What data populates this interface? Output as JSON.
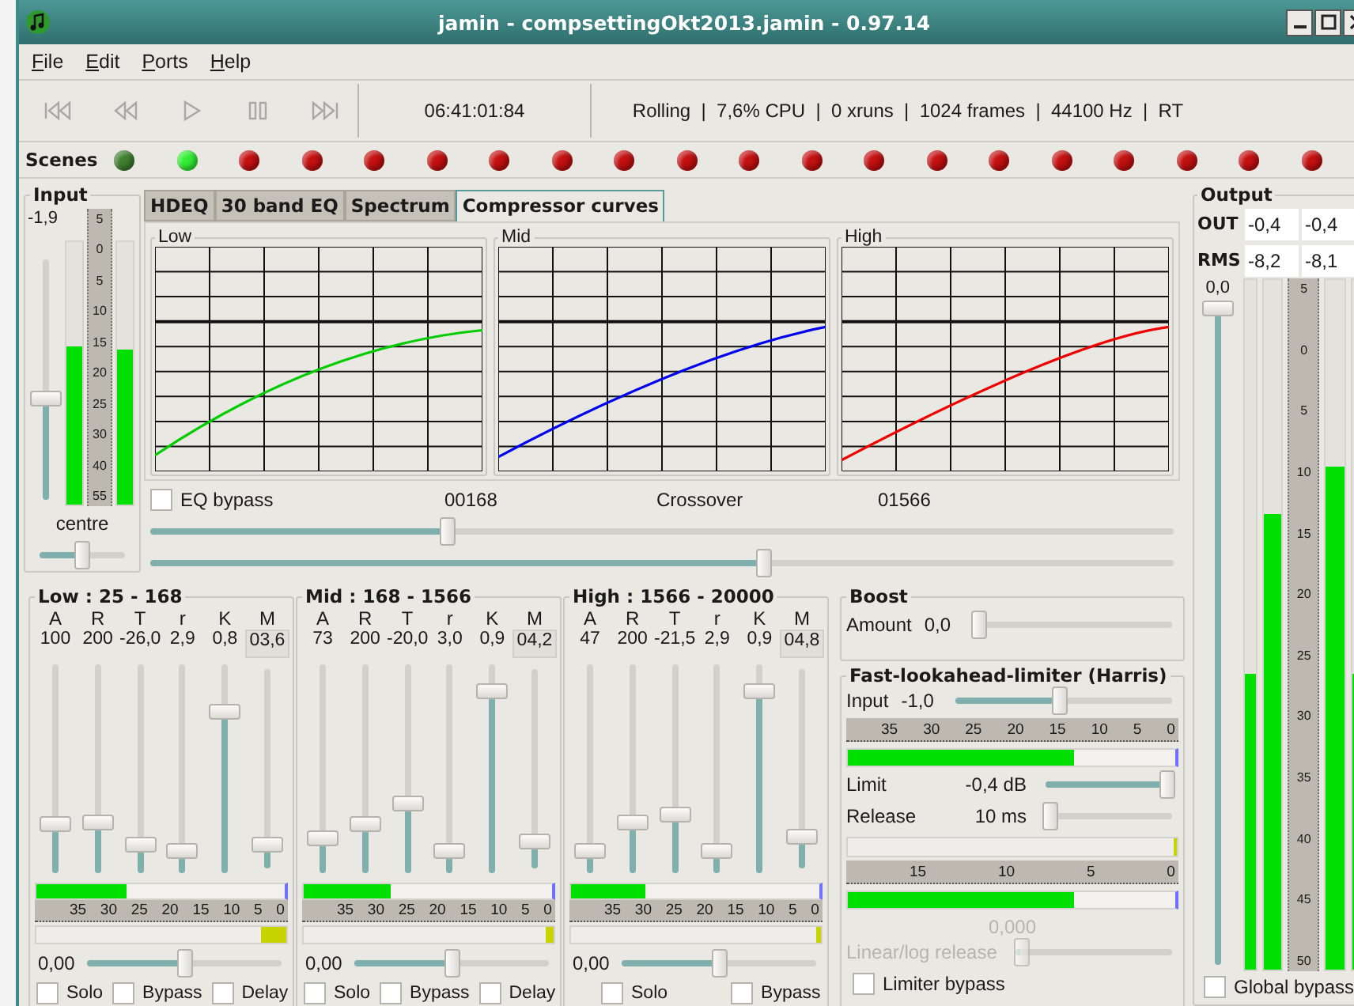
{
  "window": {
    "title": "jamin - compsettingOkt2013.jamin - 0.97.14"
  },
  "menu": [
    {
      "label": "File"
    },
    {
      "label": "Edit"
    },
    {
      "label": "Ports"
    },
    {
      "label": "Help"
    }
  ],
  "transport": {
    "buttons": [
      {
        "kind": "start"
      },
      {
        "kind": "rewind"
      },
      {
        "kind": "play"
      },
      {
        "kind": "pause"
      },
      {
        "kind": "end"
      }
    ],
    "time": "06:41:01:84",
    "status": "Rolling  |  7,6% CPU  |  0 xruns  |  1024 frames  |  44100 Hz  |  RT"
  },
  "scenes": {
    "label": "Scenes",
    "items": [
      {
        "color": "#3f7f2f"
      },
      {
        "color": "#33ee33"
      },
      {
        "color": "#c41010"
      },
      {
        "color": "#c41010"
      },
      {
        "color": "#c41010"
      },
      {
        "color": "#c41010"
      },
      {
        "color": "#c41010"
      },
      {
        "color": "#c41010"
      },
      {
        "color": "#c41010"
      },
      {
        "color": "#c41010"
      },
      {
        "color": "#c41010"
      },
      {
        "color": "#c41010"
      },
      {
        "color": "#c41010"
      },
      {
        "color": "#c41010"
      },
      {
        "color": "#c41010"
      },
      {
        "color": "#c41010"
      },
      {
        "color": "#c41010"
      },
      {
        "color": "#c41010"
      },
      {
        "color": "#c41010"
      },
      {
        "color": "#c41010"
      }
    ]
  },
  "input": {
    "title": "Input",
    "value": "-1,9",
    "fader": {
      "level": 0.42
    },
    "meters": [
      {
        "level": 0.6
      },
      {
        "level": 0.59
      }
    ],
    "scale": [
      "5",
      "0",
      "5",
      "10",
      "15",
      "20",
      "25",
      "30",
      "40",
      "55"
    ],
    "pan_label": "centre",
    "pan": {
      "level": 0.5
    }
  },
  "tabs": [
    {
      "label": "HDEQ",
      "selected": false
    },
    {
      "label": "30 band EQ",
      "selected": false
    },
    {
      "label": "Spectrum",
      "selected": false
    },
    {
      "label": "Compressor curves",
      "selected": true
    }
  ],
  "curves": [
    {
      "title": "Low",
      "color": "#00cc00"
    },
    {
      "title": "Mid",
      "color": "#0000ee"
    },
    {
      "title": "High",
      "color": "#ee0000"
    }
  ],
  "crossover": {
    "eq_bypass": {
      "label": "EQ bypass",
      "checked": false
    },
    "low_value": "00168",
    "label": "Crossover",
    "high_value": "01566",
    "sliders": [
      {
        "level": 0.29
      },
      {
        "level": 0.6
      }
    ]
  },
  "bands": [
    {
      "title": "Low : 25 - 168",
      "params": [
        {
          "label": "A",
          "value": "100",
          "kind": "fader",
          "level": 0.23
        },
        {
          "label": "R",
          "value": "200",
          "kind": "fader",
          "level": 0.24
        },
        {
          "label": "T",
          "value": "-26,0",
          "kind": "fader",
          "level": 0.13
        },
        {
          "label": "r",
          "value": "2,9",
          "kind": "fader",
          "level": 0.1
        },
        {
          "label": "K",
          "value": "0,8",
          "kind": "fader",
          "level": 0.78
        },
        {
          "label": "M",
          "value": "03,6",
          "kind": "makeup",
          "level": 0.11
        }
      ],
      "gain_meter": {
        "level": 0.36
      },
      "reduction_meter": {
        "level": 0.1
      },
      "scale": [
        "35",
        "30",
        "25",
        "20",
        "15",
        "10",
        "5",
        "0"
      ],
      "gain": {
        "value": "0,00",
        "level": 0.5
      },
      "options": [
        {
          "label": "Solo",
          "checked": false
        },
        {
          "label": "Bypass",
          "checked": false
        },
        {
          "label": "Delay",
          "checked": false
        }
      ]
    },
    {
      "title": "Mid : 168 - 1566",
      "params": [
        {
          "label": "A",
          "value": "73",
          "kind": "fader",
          "level": 0.16
        },
        {
          "label": "R",
          "value": "200",
          "kind": "fader",
          "level": 0.23
        },
        {
          "label": "T",
          "value": "-20,0",
          "kind": "fader",
          "level": 0.33
        },
        {
          "label": "r",
          "value": "3,0",
          "kind": "fader",
          "level": 0.1
        },
        {
          "label": "K",
          "value": "0,9",
          "kind": "fader",
          "level": 0.88
        },
        {
          "label": "M",
          "value": "04,2",
          "kind": "makeup",
          "level": 0.13
        }
      ],
      "gain_meter": {
        "level": 0.35
      },
      "reduction_meter": {
        "level": 0.03
      },
      "scale": [
        "35",
        "30",
        "25",
        "20",
        "15",
        "10",
        "5",
        "0"
      ],
      "gain": {
        "value": "0,00",
        "level": 0.5
      },
      "options": [
        {
          "label": "Solo",
          "checked": false
        },
        {
          "label": "Bypass",
          "checked": false
        },
        {
          "label": "Delay",
          "checked": false
        }
      ]
    },
    {
      "title": "High : 1566 - 20000",
      "params": [
        {
          "label": "A",
          "value": "47",
          "kind": "fader",
          "level": 0.1
        },
        {
          "label": "R",
          "value": "200",
          "kind": "fader",
          "level": 0.24
        },
        {
          "label": "T",
          "value": "-21,5",
          "kind": "fader",
          "level": 0.28
        },
        {
          "label": "r",
          "value": "2,9",
          "kind": "fader",
          "level": 0.1
        },
        {
          "label": "K",
          "value": "0,9",
          "kind": "fader",
          "level": 0.88
        },
        {
          "label": "M",
          "value": "04,8",
          "kind": "makeup",
          "level": 0.15
        }
      ],
      "gain_meter": {
        "level": 0.3
      },
      "reduction_meter": {
        "level": 0.02
      },
      "scale": [
        "35",
        "30",
        "25",
        "20",
        "15",
        "10",
        "5",
        "0"
      ],
      "gain": {
        "value": "0,00",
        "level": 0.5
      },
      "options": [
        {
          "label": "Solo",
          "checked": false
        },
        {
          "label": "Bypass",
          "checked": false
        }
      ]
    }
  ],
  "boost": {
    "title": "Boost",
    "label": "Amount",
    "value": "0,0",
    "level": 0
  },
  "limiter": {
    "title": "Fast-lookahead-limiter (Harris)",
    "input": {
      "label": "Input",
      "value": "-1,0",
      "level": 0.48
    },
    "input_scale": [
      "35",
      "30",
      "25",
      "20",
      "15",
      "10",
      "5",
      "0"
    ],
    "input_meter": {
      "level": 0.69
    },
    "limit": {
      "label": "Limit",
      "value": "-0,4 dB",
      "level": 0.97
    },
    "release": {
      "label": "Release",
      "value": "10 ms",
      "level": 0.02
    },
    "attenuation": {
      "level": 0.01
    },
    "attenuation_scale": [
      "15",
      "10",
      "5",
      "0"
    ],
    "output_meter": {
      "level": 0.69
    },
    "release_mode": {
      "value": "0,000",
      "label": "Linear/log release",
      "level": 0.03,
      "disabled": true
    },
    "bypass": {
      "label": "Limiter bypass",
      "checked": false
    }
  },
  "output": {
    "title": "Output",
    "rows": [
      {
        "label": "OUT",
        "values": [
          "-0,4",
          "-0,4"
        ]
      },
      {
        "label": "RMS",
        "values": [
          "-8,2",
          "-8,1"
        ]
      }
    ],
    "fader": {
      "value": "0,0",
      "level": 1
    },
    "meters": [
      {
        "kind": "rms",
        "level": 0.43
      },
      {
        "kind": "peak",
        "level": 0.66
      },
      {
        "kind": "peak",
        "level": 0.73
      },
      {
        "kind": "rms",
        "level": 0.43
      }
    ],
    "scale": [
      "5",
      "0",
      "5",
      "10",
      "15",
      "20",
      "25",
      "30",
      "35",
      "40",
      "45",
      "50"
    ],
    "bypass": {
      "label": "Global bypass",
      "checked": false
    }
  }
}
